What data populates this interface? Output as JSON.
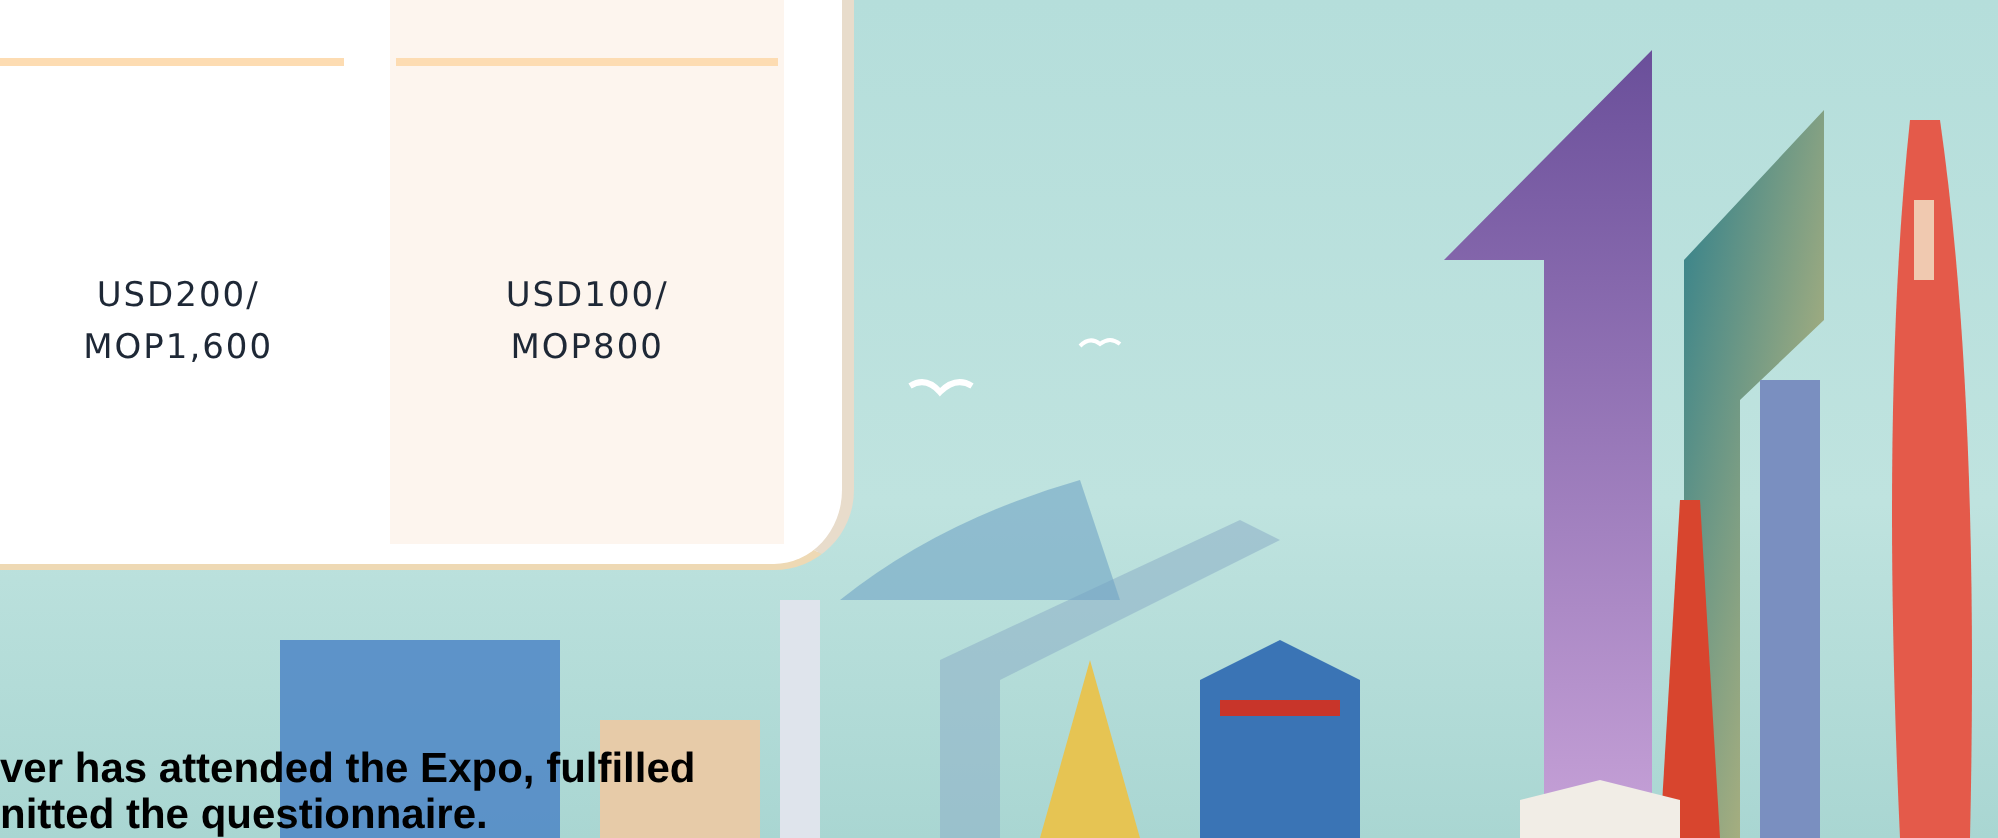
{
  "price_table": {
    "columns": [
      {
        "lines": [
          "USD200/",
          "MOP1,600"
        ],
        "highlighted": false
      },
      {
        "lines": [
          "USD100/",
          "MOP800"
        ],
        "highlighted": true
      }
    ]
  },
  "note": {
    "lines": [
      "ver has attended the Expo, fulfilled",
      "nitted the questionnaire."
    ]
  }
}
